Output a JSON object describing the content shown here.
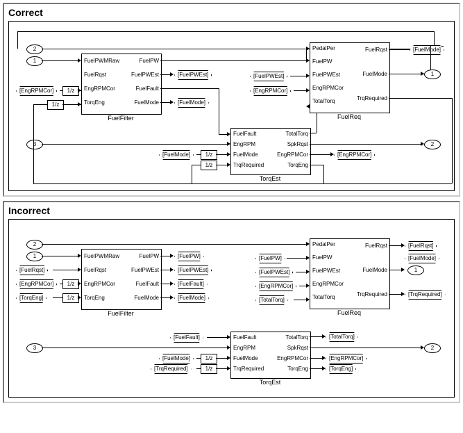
{
  "panels": {
    "correct": {
      "title": "Correct"
    },
    "incorrect": {
      "title": "Incorrect"
    }
  },
  "common": {
    "udelay": "1/z",
    "port1": "1",
    "port2": "2",
    "port3": "3"
  },
  "blocks": {
    "fuelFilter": {
      "name": "FuelFilter",
      "inPorts": [
        "FuelPWMRaw",
        "FuelRqst",
        "EngRPMCor",
        "TorqEng"
      ],
      "outPorts": [
        "FuelPW",
        "FuelPWEst",
        "FuelFault",
        "FuelMode"
      ]
    },
    "torqEst": {
      "name": "TorqEst",
      "inPorts": [
        "FuelFault",
        "EngRPM",
        "FuelMode",
        "TrqRequired"
      ],
      "outPorts": [
        "TotalTorq",
        "SpkRqst",
        "EngRPMCor",
        "TorqEng"
      ]
    },
    "fuelReq": {
      "name": "FuelReq",
      "inPorts": [
        "PedalPer",
        "FuelPW",
        "FuelPWEst",
        "EngRPMCor",
        "TotalTorq"
      ],
      "outPorts": [
        "FuelRqst",
        "FuelMode",
        "TrqRequired"
      ]
    }
  },
  "tags": {
    "EngRPMCor": "[EngRPMCor]",
    "FuelPWEst": "[FuelPWEst]",
    "FuelMode": "[FuelMode]",
    "FuelPW": "[FuelPW]",
    "FuelFault": "[FuelFault]",
    "FuelRqst": "[FuelRqst]",
    "TotalTorq": "[TotalTorq]",
    "TorqEng": "[TorqEng]",
    "TrqRequired": "[TrqRequired]"
  }
}
